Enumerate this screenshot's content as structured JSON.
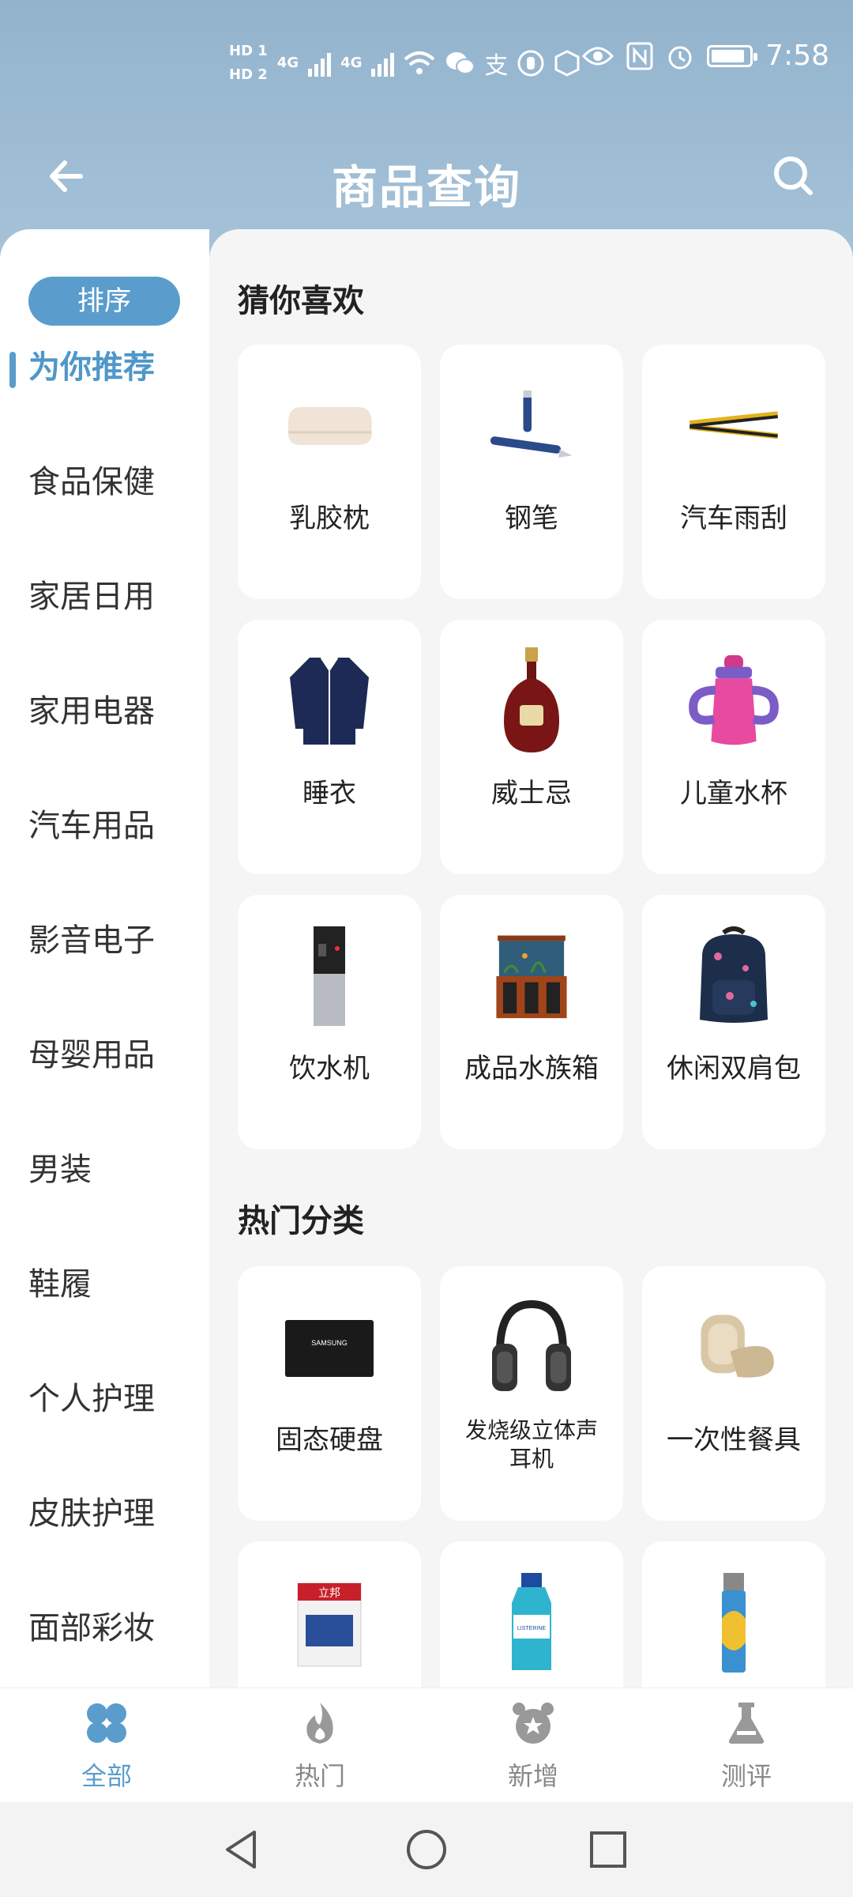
{
  "status_bar": {
    "hd1": "HD 1",
    "hd2": "HD 2",
    "net1": "4G",
    "net2": "4G",
    "alipay": "支",
    "time": "7:58",
    "battery_level": 0.9
  },
  "app_bar": {
    "title": "商品查询",
    "back_icon": "back-arrow-icon",
    "search_icon": "search-icon"
  },
  "sidebar": {
    "sort_label": "排序",
    "items": [
      {
        "label": "为你推荐",
        "active": true
      },
      {
        "label": "食品保健"
      },
      {
        "label": "家居日用"
      },
      {
        "label": "家用电器"
      },
      {
        "label": "汽车用品"
      },
      {
        "label": "影音电子"
      },
      {
        "label": "母婴用品"
      },
      {
        "label": "男装"
      },
      {
        "label": "鞋履"
      },
      {
        "label": "个人护理"
      },
      {
        "label": "皮肤护理"
      },
      {
        "label": "面部彩妆"
      }
    ]
  },
  "sections": {
    "guess_title": "猜你喜欢",
    "guess_items": [
      {
        "label": "乳胶枕",
        "icon": "latex-pillow-image"
      },
      {
        "label": "钢笔",
        "icon": "fountain-pen-image"
      },
      {
        "label": "汽车雨刮",
        "icon": "wiper-blade-image"
      },
      {
        "label": "睡衣",
        "icon": "pajamas-image"
      },
      {
        "label": "威士忌",
        "icon": "whisky-bottle-image"
      },
      {
        "label": "儿童水杯",
        "icon": "sippy-cup-image"
      },
      {
        "label": "饮水机",
        "icon": "water-dispenser-image"
      },
      {
        "label": "成品水族箱",
        "icon": "aquarium-image"
      },
      {
        "label": "休闲双肩包",
        "icon": "backpack-image"
      }
    ],
    "hot_title": "热门分类",
    "hot_items": [
      {
        "label": "固态硬盘",
        "icon": "ssd-image",
        "brand": "SAMSUNG"
      },
      {
        "label": "发烧级立体声耳机",
        "icon": "headphones-image"
      },
      {
        "label": "一次性餐具",
        "icon": "disposable-tableware-image"
      },
      {
        "label": "",
        "icon": "paint-bucket-image",
        "brand": "立邦"
      },
      {
        "label": "",
        "icon": "mouthwash-image",
        "brand": "LISTERINE"
      },
      {
        "label": "",
        "icon": "lighter-image"
      }
    ]
  },
  "bottom_nav": [
    {
      "label": "全部",
      "icon": "four-petal-icon",
      "active": true
    },
    {
      "label": "热门",
      "icon": "flame-icon"
    },
    {
      "label": "新增",
      "icon": "new-badge-icon"
    },
    {
      "label": "测评",
      "icon": "flask-icon"
    }
  ],
  "colors": {
    "accent": "#5a9dcc",
    "header": "#9ab9d2",
    "content_bg": "#f5f5f6"
  }
}
